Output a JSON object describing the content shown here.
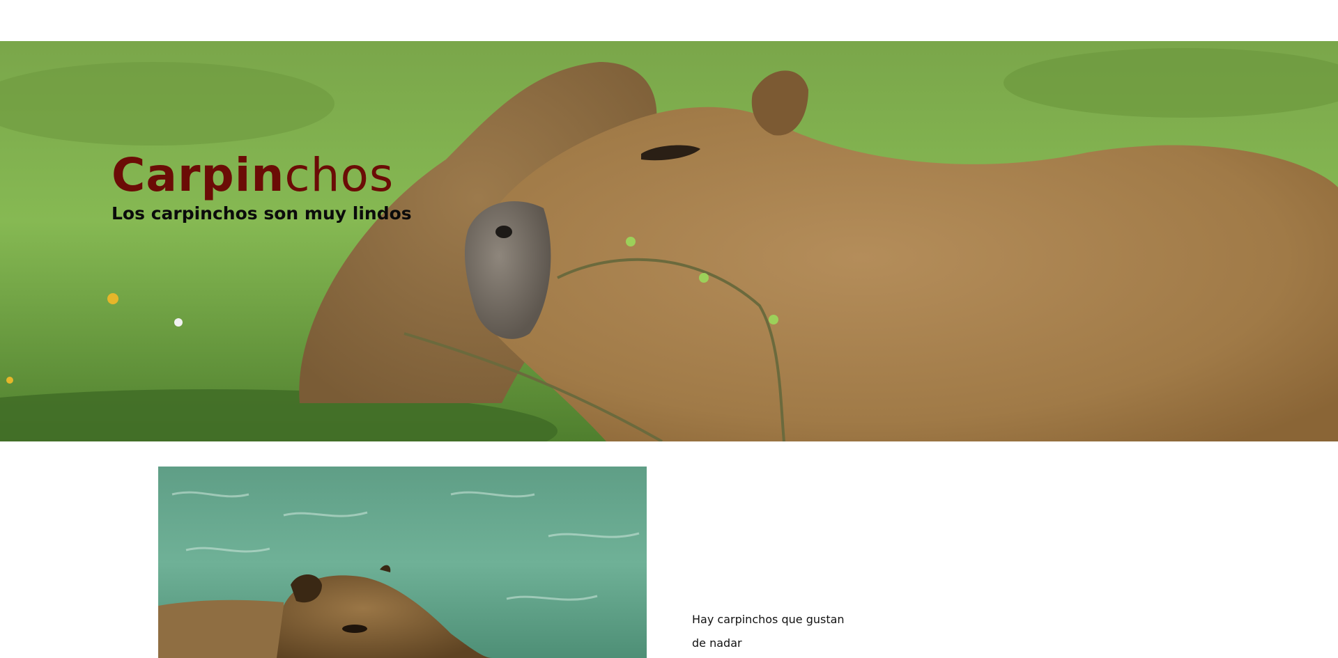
{
  "hero": {
    "title_bold": "Carpin",
    "title_light": "chos",
    "subtitle": "Los carpinchos son muy lindos",
    "title_color": "#6b0c06"
  },
  "content": {
    "caption": "Hay carpinchos que gustan de nadar"
  },
  "images": {
    "hero_image": "capybara-on-grass",
    "content_image": "capybara-swimming"
  }
}
